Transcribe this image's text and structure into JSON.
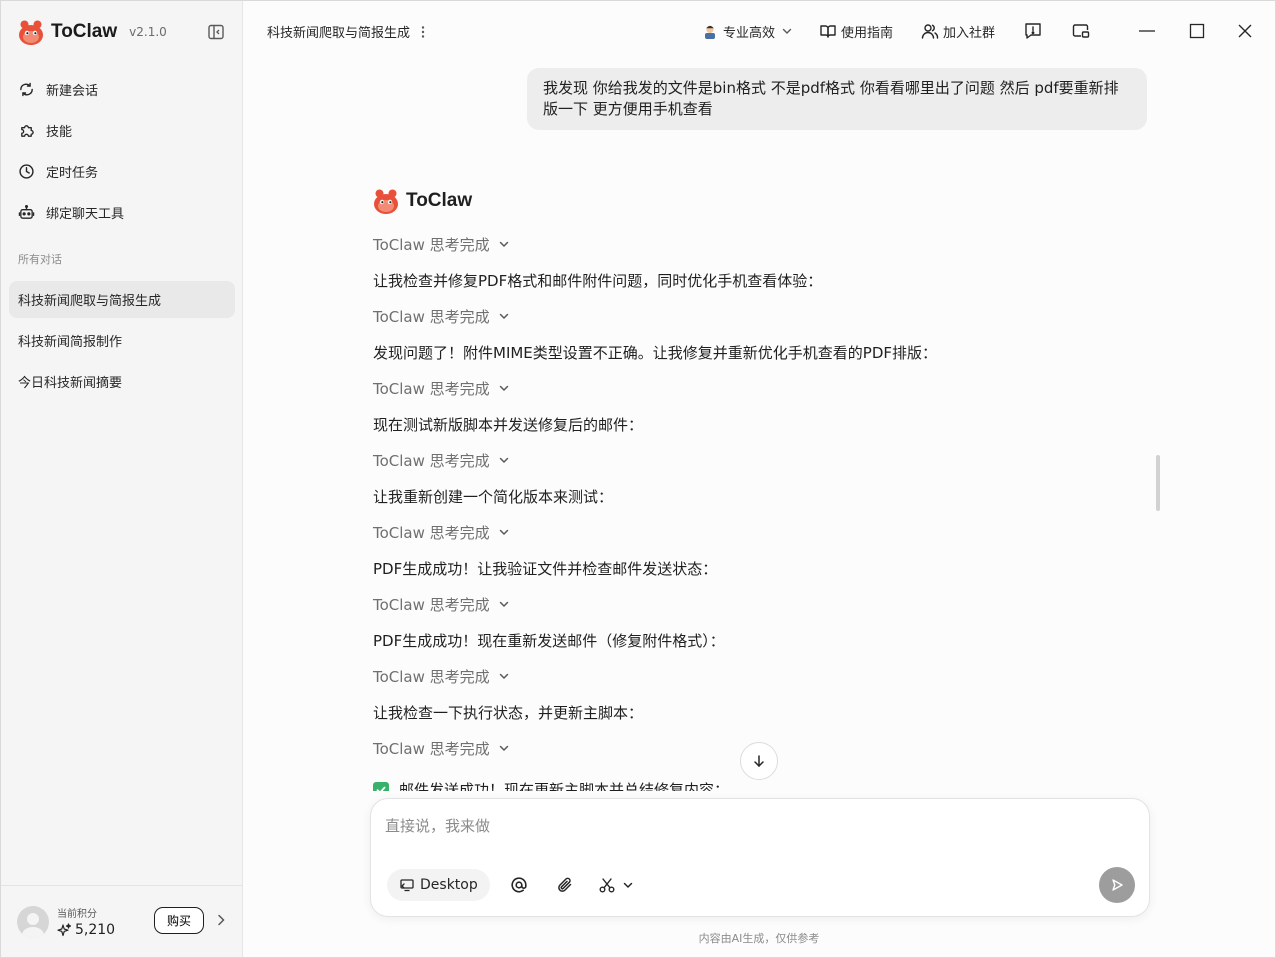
{
  "app": {
    "name": "ToClaw",
    "version": "v2.1.0"
  },
  "sidebar": {
    "nav": [
      {
        "label": "新建会话",
        "icon": "new-chat-icon"
      },
      {
        "label": "技能",
        "icon": "puzzle-icon"
      },
      {
        "label": "定时任务",
        "icon": "clock-icon"
      },
      {
        "label": "绑定聊天工具",
        "icon": "bot-icon"
      }
    ],
    "section_label": "所有对话",
    "conversations": [
      {
        "label": "科技新闻爬取与简报生成",
        "active": true
      },
      {
        "label": "科技新闻简报制作",
        "active": false
      },
      {
        "label": "今日科技新闻摘要",
        "active": false
      }
    ],
    "user": {
      "points_label": "当前积分",
      "points": "5,210",
      "buy_label": "购买"
    }
  },
  "header": {
    "conversation_title": "科技新闻爬取与简报生成",
    "mode_label": "专业高效",
    "guide_label": "使用指南",
    "community_label": "加入社群"
  },
  "chat": {
    "user_message": "我发现 你给我发的文件是bin格式 不是pdf格式 你看看哪里出了问题 然后 pdf要重新排版一下 更方便用手机查看",
    "bot_name": "ToClaw",
    "thinking_label": "ToClaw 思考完成",
    "steps": [
      "让我检查并修复PDF格式和邮件附件问题，同时优化手机查看体验：",
      "发现问题了！附件MIME类型设置不正确。让我修复并重新优化手机查看的PDF排版：",
      "现在测试新版脚本并发送修复后的邮件：",
      "让我重新创建一个简化版本来测试：",
      "PDF生成成功！让我验证文件并检查邮件发送状态：",
      "PDF生成成功！现在重新发送邮件（修复附件格式）：",
      "让我检查一下执行状态，并更新主脚本："
    ],
    "final_line": "邮件发送成功！现在更新主脚本并总结修复内容："
  },
  "composer": {
    "placeholder": "直接说，我来做",
    "desktop_chip": "Desktop"
  },
  "footer": {
    "disclaimer": "内容由AI生成，仅供参考"
  },
  "colors": {
    "accent_red": "#e8503a",
    "check_green": "#38b26a",
    "send_gray": "#9d9d9d"
  }
}
